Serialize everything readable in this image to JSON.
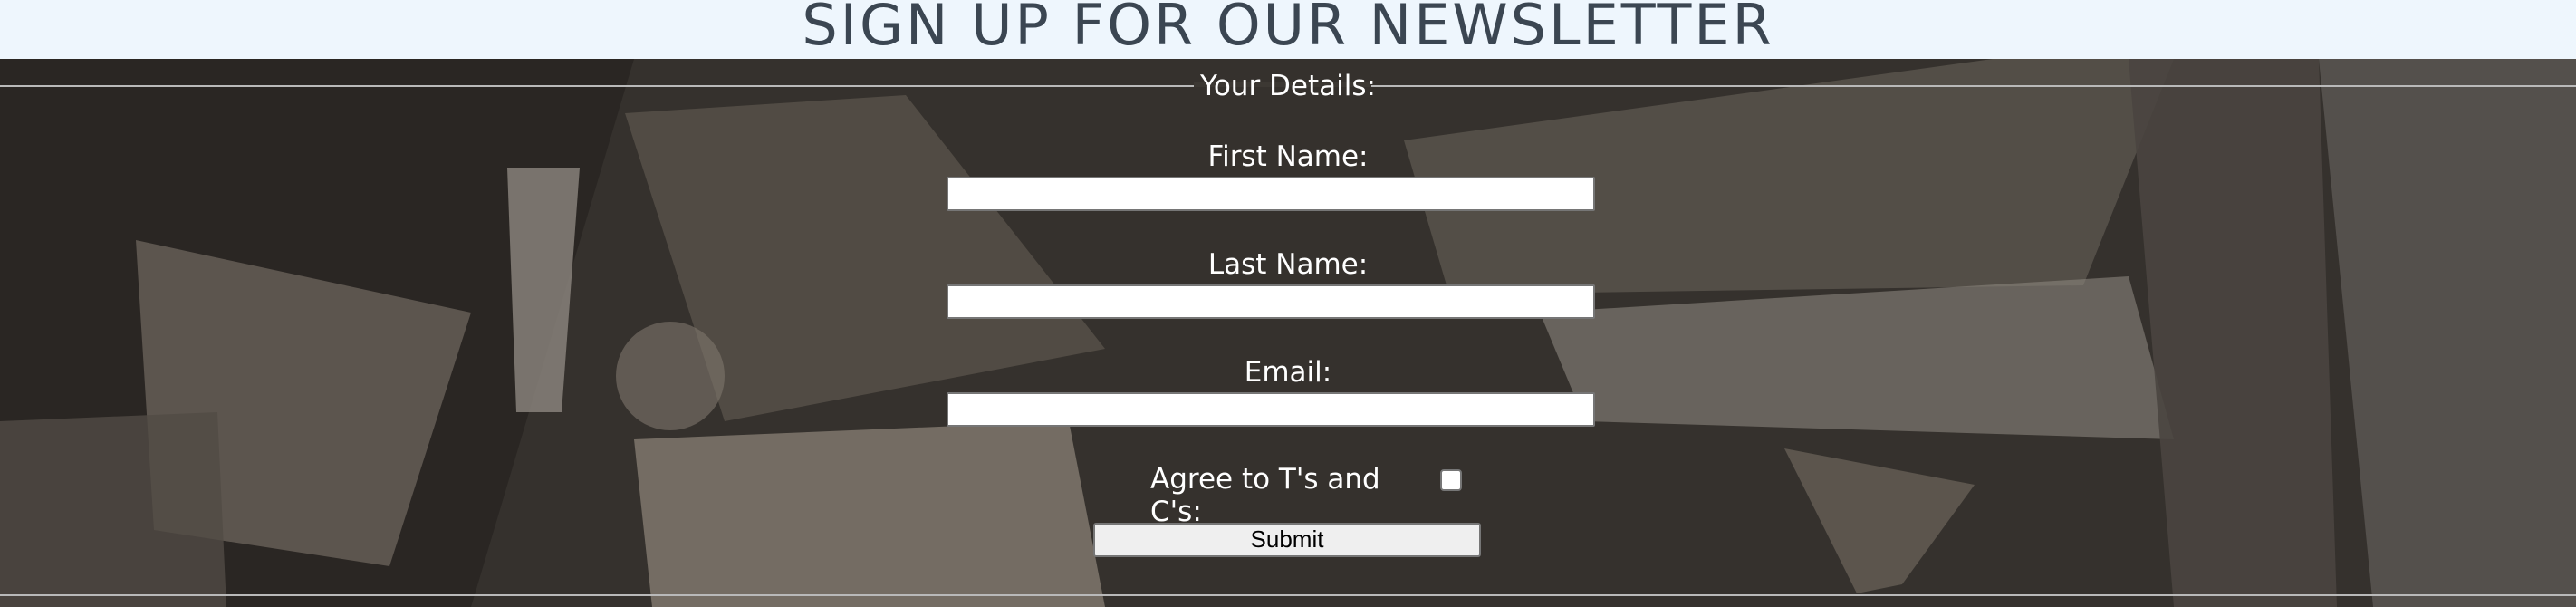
{
  "header": {
    "title": "SIGN UP FOR OUR NEWSLETTER"
  },
  "form": {
    "legend": "Your Details:",
    "fields": [
      {
        "label": "First Name:",
        "value": ""
      },
      {
        "label": "Last Name:",
        "value": ""
      },
      {
        "label": "Email:",
        "value": ""
      }
    ],
    "agree_label": "Agree to T's and C's:",
    "agree_checked": false,
    "submit_label": "Submit"
  },
  "background": {
    "icon": "sepia-photo-background",
    "tone": "#3c3833"
  }
}
